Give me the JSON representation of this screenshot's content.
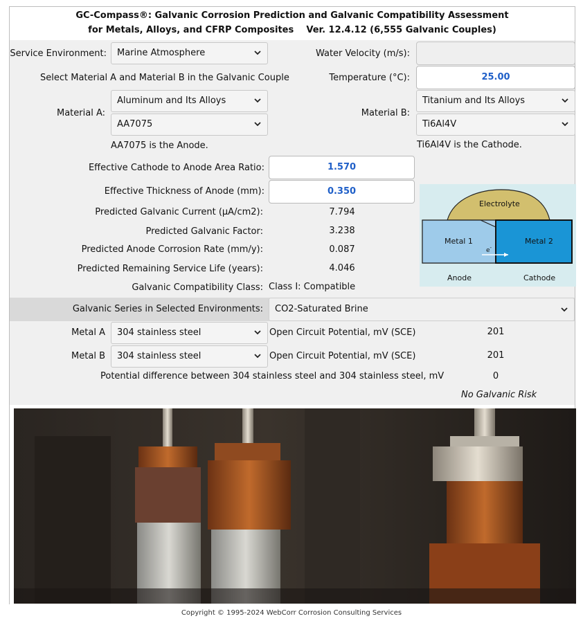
{
  "header": {
    "title_line1": "GC-Compass®: Galvanic Corrosion Prediction and Galvanic Compatibility Assessment",
    "title_line2": "for Metals, Alloys, and CFRP Composites    Ver. 12.4.12 (6,555 Galvanic Couples)"
  },
  "form": {
    "service_env_label": "Service Environment:",
    "service_env_value": "Marine Atmosphere",
    "water_velocity_label": "Water Velocity (m/s):",
    "water_velocity_value": "",
    "select_instruction": "Select Material A and Material B in the Galvanic Couple",
    "temperature_label": "Temperature (°C):",
    "temperature_value": "25.00",
    "material_a_label": "Material A:",
    "material_a_family": "Aluminum and Its Alloys",
    "material_a_alloy": "AA7075",
    "material_a_role": "AA7075 is the Anode.",
    "material_b_label": "Material B:",
    "material_b_family": "Titanium and Its Alloys",
    "material_b_alloy": "Ti6Al4V",
    "material_b_role": "Ti6Al4V is the Cathode.",
    "area_ratio_label": "Effective Cathode to Anode Area Ratio:",
    "area_ratio_value": "1.570",
    "thickness_label": "Effective Thickness of Anode (mm):",
    "thickness_value": "0.350"
  },
  "results": {
    "current_label": "Predicted Galvanic Current (µA/cm2):",
    "current_value": "7.794",
    "factor_label": "Predicted Galvanic Factor:",
    "factor_value": "3.238",
    "rate_label": "Predicted Anode Corrosion Rate (mm/y):",
    "rate_value": "0.087",
    "life_label": "Predicted Remaining Service Life (years):",
    "life_value": "4.046",
    "class_label": "Galvanic Compatibility Class:",
    "class_value": "Class I: Compatible"
  },
  "diagram": {
    "electrolyte": "Electrolyte",
    "metal1": "Metal 1",
    "metal2": "Metal 2",
    "electron": "e",
    "anode": "Anode",
    "cathode": "Cathode"
  },
  "series": {
    "label": "Galvanic Series in Selected Environments:",
    "value": "CO2-Saturated Brine",
    "metal_a_label": "Metal A",
    "metal_a_value": "304 stainless steel",
    "metal_a_ocp_label": "Open Circuit Potential, mV (SCE)",
    "metal_a_ocp_value": "201",
    "metal_b_label": "Metal B",
    "metal_b_value": "304 stainless steel",
    "metal_b_ocp_label": "Open Circuit Potential, mV (SCE)",
    "metal_b_ocp_value": "201",
    "diff_label": "Potential difference between 304 stainless steel and 304 stainless steel, mV",
    "diff_value": "0",
    "risk_text": "No Galvanic Risk"
  },
  "footer": {
    "copyright": "Copyright © 1995-2024 WebCorr Corrosion Consulting Services"
  },
  "colors": {
    "value_blue": "#1f5fc8",
    "band_gray": "#d9d9d9",
    "panel_gray": "#f0f0f0"
  }
}
